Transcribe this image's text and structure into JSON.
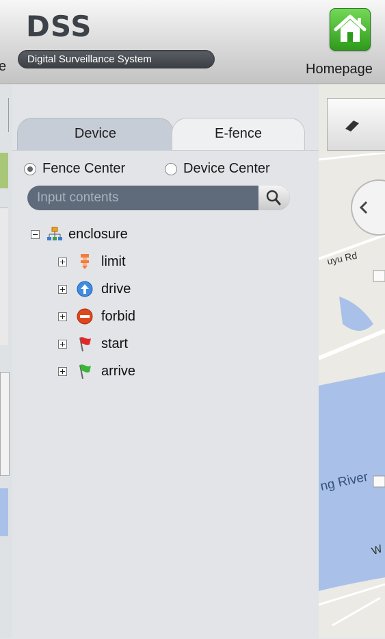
{
  "header": {
    "brand": "DSS",
    "tagline": "Digital Surveillance System",
    "left_cut_text": "e",
    "home_label": "Homepage",
    "home_icon": "house-icon"
  },
  "panel": {
    "tabs": [
      {
        "label": "Device",
        "active": false
      },
      {
        "label": "E-fence",
        "active": true
      }
    ],
    "radio": {
      "fence_center": "Fence Center",
      "device_center": "Device Center",
      "selected": "Fence Center"
    },
    "search": {
      "placeholder": "Input contents",
      "value": "",
      "icon": "search-icon"
    },
    "tree": {
      "root": {
        "label": "enclosure",
        "icon": "network-icon"
      },
      "children": [
        {
          "label": "limit",
          "icon": "limit-icon"
        },
        {
          "label": "drive",
          "icon": "drive-arrow-icon"
        },
        {
          "label": "forbid",
          "icon": "forbid-icon"
        },
        {
          "label": "start",
          "icon": "red-flag-icon"
        },
        {
          "label": "arrive",
          "icon": "green-flag-icon"
        }
      ]
    }
  },
  "map": {
    "road_label": "uyu Rd",
    "river_label": "ng River",
    "corner_label": "W"
  },
  "colors": {
    "panel_bg": "#e2e4e7",
    "search_bg": "#5f6b7b",
    "home_green": "#3fae2a",
    "water": "#a9c1e8"
  }
}
